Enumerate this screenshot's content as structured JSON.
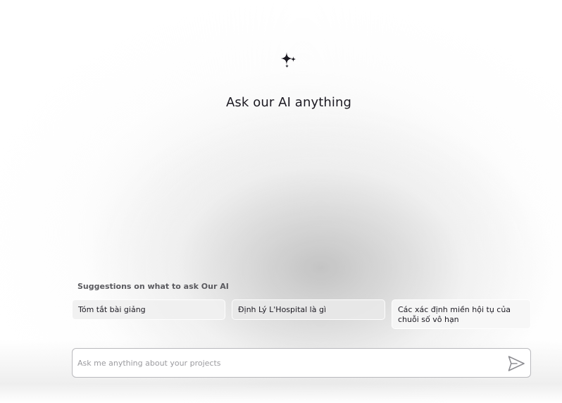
{
  "header": {
    "icon": "sparkles-icon",
    "title": "Ask our AI anything"
  },
  "suggestions": {
    "heading": "Suggestions on what to ask Our AI",
    "items": [
      {
        "label": "Tóm tắt bài giảng"
      },
      {
        "label": "Định Lý L'Hospital là gì"
      },
      {
        "label": "Các xác định miền hội tụ của chuỗi số vô hạn"
      }
    ]
  },
  "prompt": {
    "placeholder": "Ask me anything about your projects",
    "value": "",
    "send_icon": "send-icon"
  },
  "colors": {
    "text": "#1c1a22",
    "muted": "#5a5a5f",
    "input_border": "#b9b9bd"
  }
}
